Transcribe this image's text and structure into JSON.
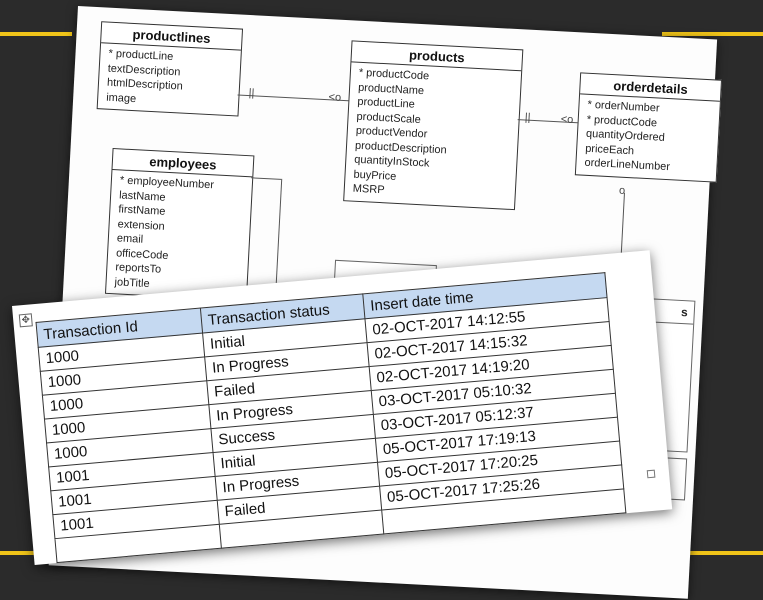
{
  "erd": {
    "entities": [
      {
        "id": "productlines",
        "title": "productlines",
        "fields": [
          "* productLine",
          "textDescription",
          "htmlDescription",
          "image"
        ]
      },
      {
        "id": "products",
        "title": "products",
        "fields": [
          "* productCode",
          "productName",
          "productLine",
          "productScale",
          "productVendor",
          "productDescription",
          "quantityInStock",
          "buyPrice",
          "MSRP"
        ]
      },
      {
        "id": "orderdetails",
        "title": "orderdetails",
        "fields": [
          "* orderNumber",
          "* productCode",
          "quantityOrdered",
          "priceEach",
          "orderLineNumber"
        ]
      },
      {
        "id": "employees",
        "title": "employees",
        "fields": [
          "* employeeNumber",
          "lastName",
          "firstName",
          "extension",
          "email",
          "officeCode",
          "reportsTo",
          "jobTitle"
        ]
      }
    ],
    "partial_box_title": "s"
  },
  "table": {
    "headers": [
      "Transaction Id",
      "Transaction status",
      "Insert date time"
    ],
    "rows": [
      [
        "1000",
        "Initial",
        "02-OCT-2017 14:12:55"
      ],
      [
        "1000",
        "In Progress",
        "02-OCT-2017 14:15:32"
      ],
      [
        "1000",
        "Failed",
        "02-OCT-2017 14:19:20"
      ],
      [
        "1000",
        "In Progress",
        "03-OCT-2017 05:10:32"
      ],
      [
        "1000",
        "Success",
        "03-OCT-2017 05:12:37"
      ],
      [
        "1001",
        "Initial",
        "05-OCT-2017 17:19:13"
      ],
      [
        "1001",
        "In Progress",
        "05-OCT-2017 17:20:25"
      ],
      [
        "1001",
        "Failed",
        "05-OCT-2017 17:25:26"
      ],
      [
        "",
        "",
        ""
      ]
    ]
  },
  "colors": {
    "background": "#2b2b2b",
    "accent": "#f0c419",
    "header_fill": "#c5d9f1"
  },
  "icons": {
    "move_handle": "move-icon"
  }
}
